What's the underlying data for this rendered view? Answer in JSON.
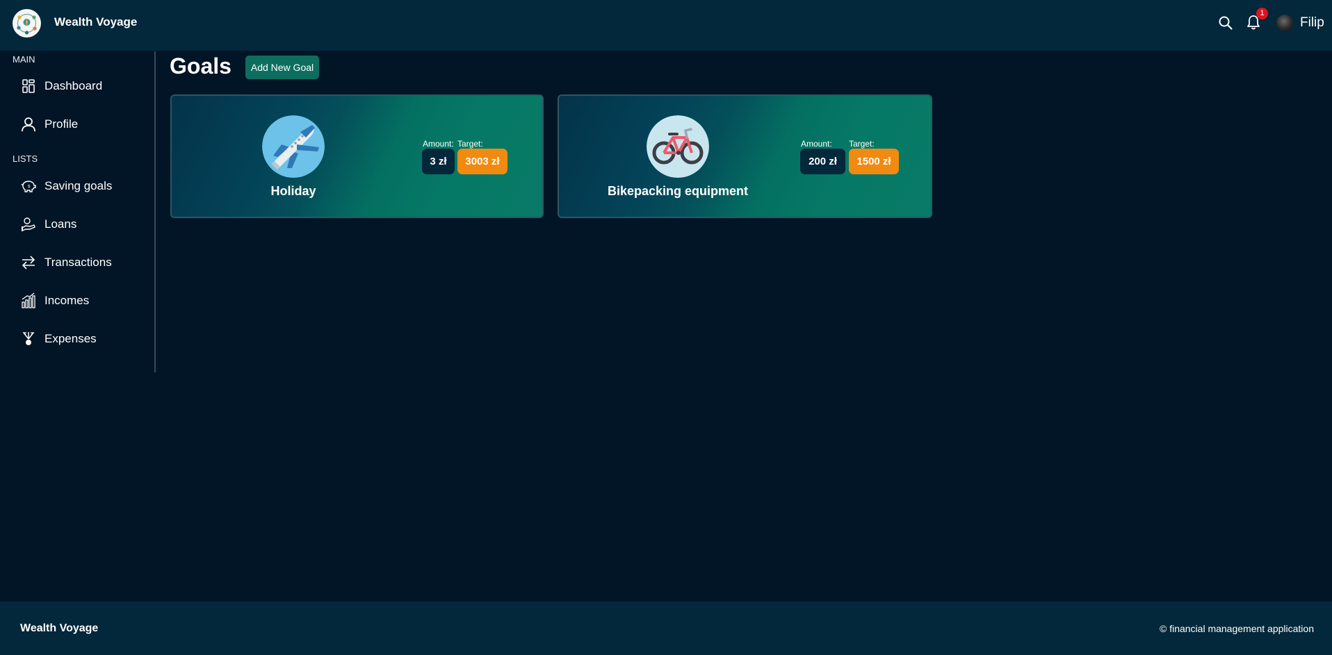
{
  "header": {
    "app_title": "Wealth Voyage",
    "notification_count": "1",
    "user_name": "Filip"
  },
  "sidebar": {
    "sections": [
      {
        "label": "MAIN"
      },
      {
        "label": "LISTS"
      }
    ],
    "items": [
      {
        "label": "Dashboard",
        "icon": "dashboard-icon"
      },
      {
        "label": "Profile",
        "icon": "user-icon"
      },
      {
        "label": "Saving goals",
        "icon": "piggy-bank-icon"
      },
      {
        "label": "Loans",
        "icon": "loan-hand-icon"
      },
      {
        "label": "Transactions",
        "icon": "transfer-arrows-icon"
      },
      {
        "label": "Incomes",
        "icon": "income-chart-icon"
      },
      {
        "label": "Expenses",
        "icon": "expenses-icon"
      }
    ]
  },
  "main": {
    "title": "Goals",
    "add_button": "Add New Goal",
    "goals": [
      {
        "name": "Holiday",
        "icon": "airplane-icon",
        "amount_label": "Amount:",
        "target_label": "Target:",
        "amount": "3 zł",
        "target": "3003 zł"
      },
      {
        "name": "Bikepacking equipment",
        "icon": "bicycle-icon",
        "amount_label": "Amount:",
        "target_label": "Target:",
        "amount": "200 zł",
        "target": "1500 zł"
      }
    ]
  },
  "footer": {
    "brand": "Wealth Voyage",
    "copyright": "© financial management application"
  },
  "colors": {
    "background": "#021526",
    "header": "#03273b",
    "accent": "#0d6e5f",
    "target_badge": "#f08a10",
    "notification": "#e1131c"
  }
}
